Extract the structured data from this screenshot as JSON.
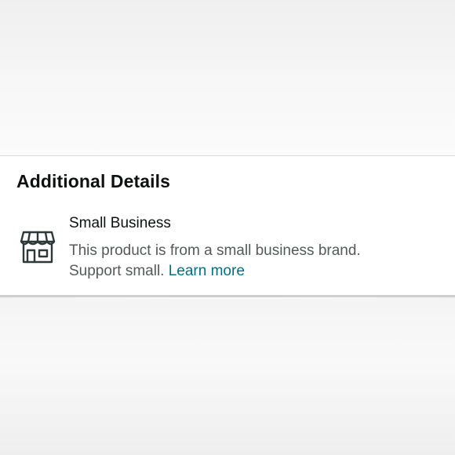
{
  "section": {
    "title": "Additional Details"
  },
  "feature": {
    "icon": "storefront-icon",
    "name": "Small Business",
    "description_line1": "This product is from a small business brand.",
    "description_line2": "Support small.",
    "link_label": "Learn more"
  },
  "colors": {
    "title": "#0f1111",
    "body_text": "#565959",
    "link": "#007185"
  }
}
